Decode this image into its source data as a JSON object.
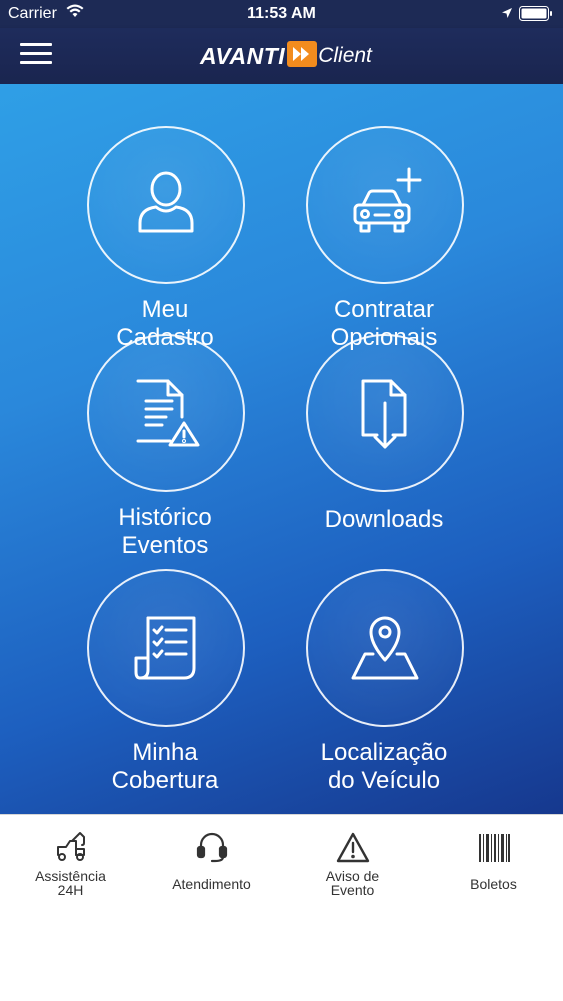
{
  "status_bar": {
    "carrier": "Carrier",
    "time": "11:53 AM"
  },
  "header": {
    "brand": "AVANTI",
    "brand_suffix": "Client",
    "accent_color": "#f28c1e"
  },
  "menu": [
    {
      "line1": "Meu",
      "line2": "Cadastro",
      "icon": "user-icon"
    },
    {
      "line1": "Contratar",
      "line2": "Opcionais",
      "icon": "car-plus-icon"
    },
    {
      "line1": "Histórico",
      "line2": "Eventos",
      "icon": "document-warning-icon"
    },
    {
      "line1": "Downloads",
      "line2": "",
      "icon": "download-file-icon"
    },
    {
      "line1": "Minha",
      "line2": "Cobertura",
      "icon": "checklist-icon"
    },
    {
      "line1": "Localização",
      "line2": "do Veículo",
      "icon": "map-pin-icon"
    }
  ],
  "tabs": [
    {
      "line1": "Assistência",
      "line2": "24H",
      "icon": "tow-truck-icon"
    },
    {
      "line1": "Atendimento",
      "line2": "",
      "icon": "headset-icon"
    },
    {
      "line1": "Aviso de",
      "line2": "Evento",
      "icon": "warning-icon"
    },
    {
      "line1": "Boletos",
      "line2": "",
      "icon": "barcode-icon"
    }
  ]
}
